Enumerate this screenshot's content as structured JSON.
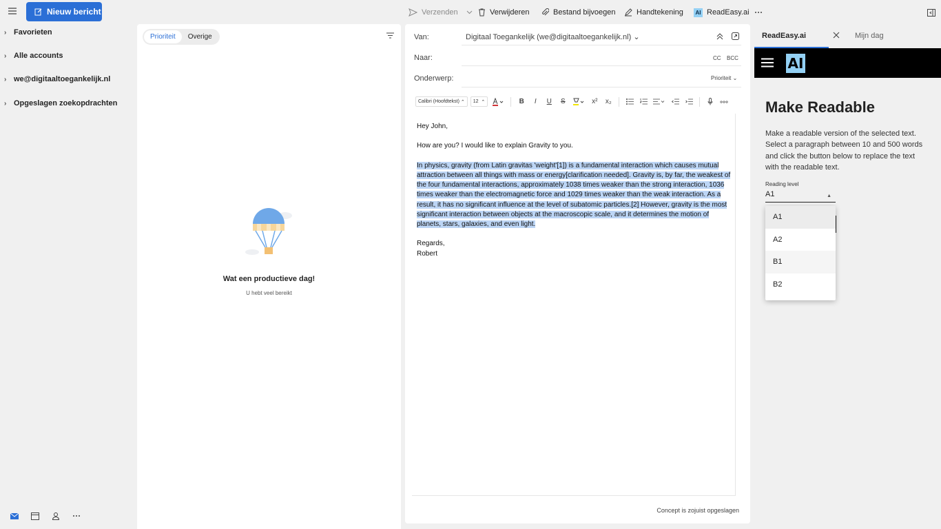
{
  "toolbar": {
    "new_message": "Nieuw bericht",
    "send": "Verzenden",
    "delete": "Verwijderen",
    "attach": "Bestand bijvoegen",
    "signature": "Handtekening",
    "readeasy_badge": "AI",
    "readeasy": "ReadEasy.ai",
    "more_icon": "ellipsis-icon",
    "colors": {
      "primary": "#2b6fd6",
      "readeasy_badge": "#93d0f4"
    }
  },
  "folders": {
    "items": [
      {
        "label": "Favorieten"
      },
      {
        "label": "Alle accounts"
      },
      {
        "label": "we@digitaaltoegankelijk.nl"
      },
      {
        "label": "Opgeslagen zoekopdrachten"
      }
    ]
  },
  "list": {
    "tabs": [
      {
        "label": "Prioriteit"
      },
      {
        "label": "Overige"
      }
    ],
    "empty_title": "Wat een productieve dag!",
    "empty_subtitle": "U hebt veel bereikt"
  },
  "compose": {
    "from_label": "Van:",
    "from_value": "Digitaal Toegankelijk (we@digitaaltoegankelijk.nl)",
    "to_label": "Naar:",
    "cc": "CC",
    "bcc": "BCC",
    "subject_label": "Onderwerp:",
    "priority": "Prioriteit",
    "font": "Calibri (Hoofdtekst)",
    "font_size": "12",
    "body": {
      "greeting": "Hey John,",
      "line1": "How are you? I would like to explain Gravity to you.",
      "selected": "In physics, gravity (from Latin gravitas 'weight'[1]) is a fundamental interaction which causes mutual attraction between all things with mass or energy[clarification needed]. Gravity is, by far, the weakest of the four fundamental interactions, approximately 1038 times weaker than the strong interaction, 1036 times weaker than the electromagnetic force and 1029 times weaker than the weak interaction. As a result, it has no significant influence at the level of subatomic particles.[2] However, gravity is the most significant interaction between objects at the macroscopic scale, and it determines the motion of planets, stars, galaxies, and even light.",
      "closing": "Regards,",
      "name": "Robert"
    },
    "draft_status": "Concept is zojuist opgeslagen"
  },
  "addin": {
    "tab_active": "ReadEasy.ai",
    "tab_other": "Mijn dag",
    "logo": "AI",
    "title": "Make Readable",
    "description": "Make a readable version of the selected text. Select a paragraph between 10 and 500 words and click the button below to replace the text with the readable text.",
    "level_label": "Reading level",
    "level_value": "A1",
    "level_options": [
      {
        "label": "A1"
      },
      {
        "label": "A2"
      },
      {
        "label": "B1"
      },
      {
        "label": "B2"
      }
    ]
  }
}
